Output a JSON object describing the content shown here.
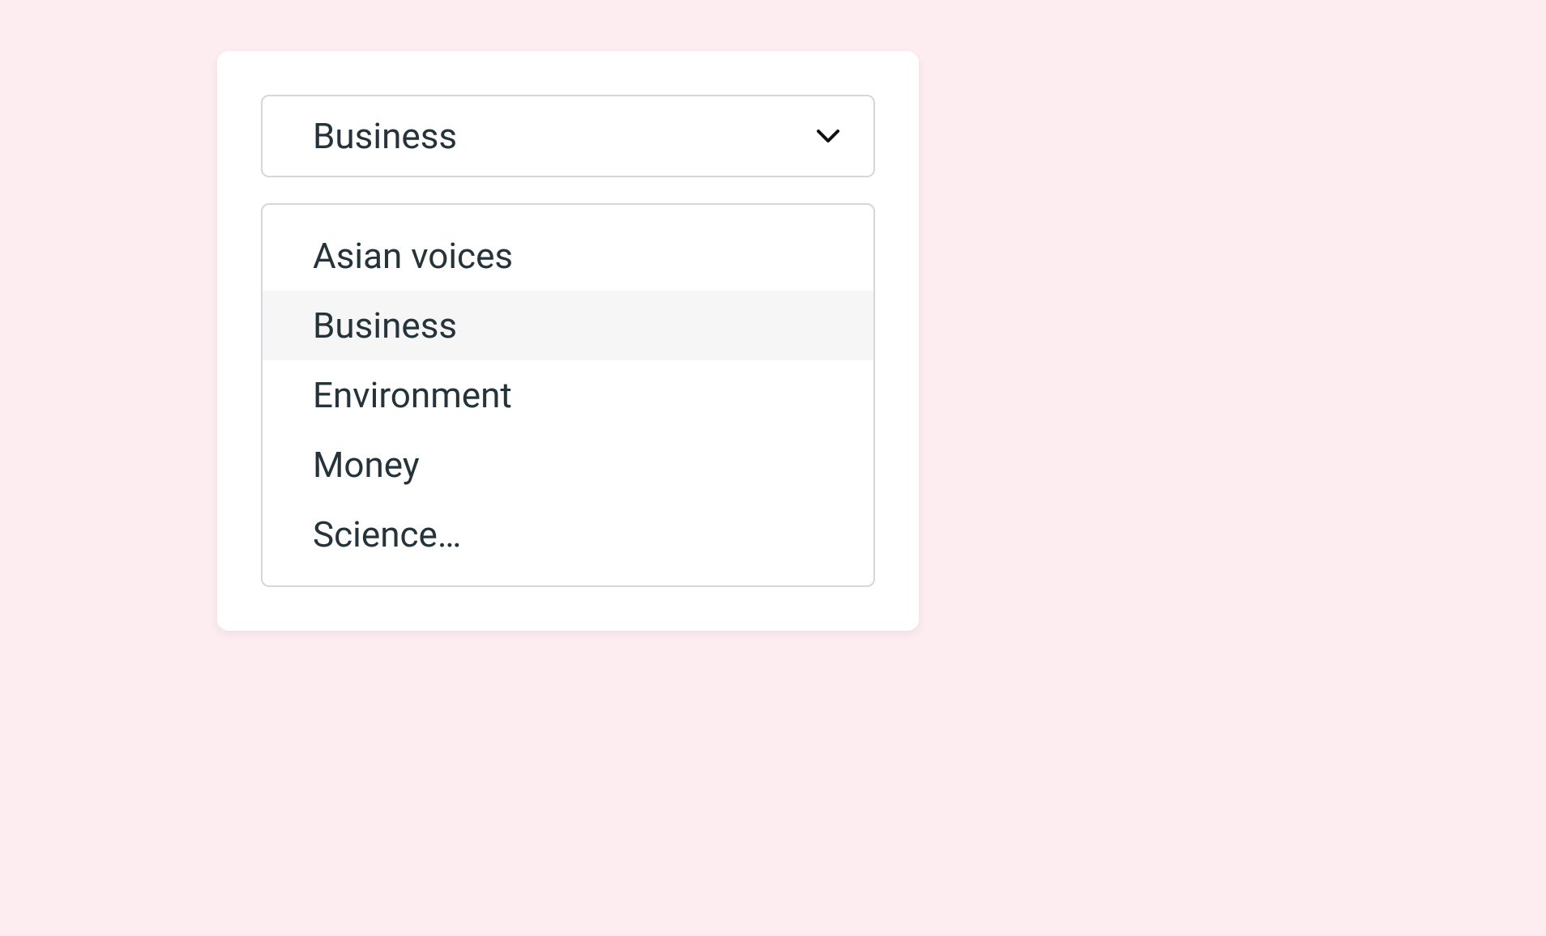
{
  "select": {
    "selected_label": "Business",
    "selected_index": 1,
    "options": [
      {
        "label": "Asian voices"
      },
      {
        "label": "Business"
      },
      {
        "label": "Environment"
      },
      {
        "label": "Money"
      },
      {
        "label": "Science…"
      }
    ]
  },
  "colors": {
    "background": "#fdedf1",
    "card": "#ffffff",
    "border": "#d5d7db",
    "text": "#25333a",
    "option_selected_bg": "#f6f6f6"
  }
}
